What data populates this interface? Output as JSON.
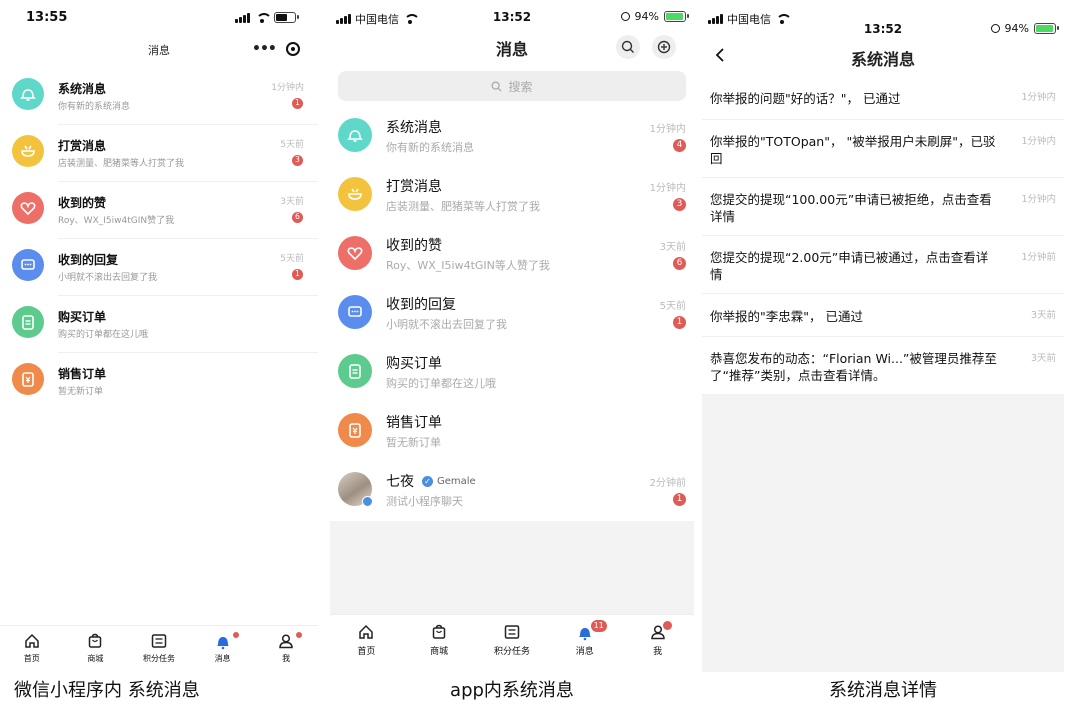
{
  "colors": {
    "system": "#5fd8c9",
    "reward": "#f4c33e",
    "like": "#ee6f68",
    "reply": "#5b8def",
    "buy": "#5ccb8d",
    "sell": "#f08a4b",
    "badge": "#e05a56"
  },
  "panels": [
    {
      "status_time": "13:55",
      "header_title": "消息",
      "items": [
        {
          "icon": "bell-icon",
          "title": "系统消息",
          "sub": "你有新的系统消息",
          "time": "1分钟内",
          "badge": "1"
        },
        {
          "icon": "reward-bowl-icon",
          "title": "打赏消息",
          "sub": "店装测量、肥猪菜等人打赏了我",
          "time": "5天前",
          "badge": "3"
        },
        {
          "icon": "heart-icon",
          "title": "收到的赞",
          "sub": "Roy、WX_I5iw4tGIN赞了我",
          "time": "3天前",
          "badge": "6"
        },
        {
          "icon": "chat-bubble-icon",
          "title": "收到的回复",
          "sub": "小明就不滚出去回复了我",
          "time": "5天前",
          "badge": "1"
        },
        {
          "icon": "clipboard-icon",
          "title": "购买订单",
          "sub": "购买的订单都在这儿哦",
          "time": "",
          "badge": ""
        },
        {
          "icon": "yuan-receipt-icon",
          "title": "销售订单",
          "sub": "暂无新订单",
          "time": "",
          "badge": ""
        }
      ],
      "tabs": [
        "首页",
        "商城",
        "积分任务",
        "消息",
        "我"
      ],
      "caption": "微信小程序内 系统消息"
    },
    {
      "carrier": "中国电信",
      "status_time": "13:52",
      "battery": "94%",
      "header_title": "消息",
      "search_placeholder": "搜索",
      "items": [
        {
          "icon": "bell-icon",
          "title": "系统消息",
          "sub": "你有新的系统消息",
          "time": "1分钟内",
          "badge": "4"
        },
        {
          "icon": "reward-bowl-icon",
          "title": "打赏消息",
          "sub": "店装测量、肥猪菜等人打赏了我",
          "time": "1分钟内",
          "badge": "3"
        },
        {
          "icon": "heart-icon",
          "title": "收到的赞",
          "sub": "Roy、WX_I5iw4tGIN等人赞了我",
          "time": "3天前",
          "badge": "6"
        },
        {
          "icon": "chat-bubble-icon",
          "title": "收到的回复",
          "sub": "小明就不滚出去回复了我",
          "time": "5天前",
          "badge": "1"
        },
        {
          "icon": "clipboard-icon",
          "title": "购买订单",
          "sub": "购买的订单都在这儿哦",
          "time": "",
          "badge": ""
        },
        {
          "icon": "yuan-receipt-icon",
          "title": "销售订单",
          "sub": "暂无新订单",
          "time": "",
          "badge": ""
        },
        {
          "icon": "user-avatar-photo",
          "title": "七夜",
          "verified_name": "Gemale",
          "sub": "测试小程序聊天",
          "time": "2分钟前",
          "badge": "1"
        }
      ],
      "tabs": [
        "首页",
        "商城",
        "积分任务",
        "消息",
        "我"
      ],
      "tab_badge": "11",
      "caption": "app内系统消息"
    },
    {
      "carrier": "中国电信",
      "status_time": "13:52",
      "battery": "94%",
      "header_title": "系统消息",
      "items": [
        {
          "text": "你举报的问题\"好的话？\"， 已通过",
          "time": "1分钟内"
        },
        {
          "text": "你举报的\"TOTOpan\"， \"被举报用户未刷屏\"，已驳回",
          "time": "1分钟内"
        },
        {
          "text": "您提交的提现“100.00元”申请已被拒绝，点击查看详情",
          "time": "1分钟内"
        },
        {
          "text": "您提交的提现“2.00元”申请已被通过，点击查看详情",
          "time": "1分钟前"
        },
        {
          "text": "你举报的\"李忠霖\"， 已通过",
          "time": "3天前"
        },
        {
          "text": "恭喜您发布的动态：“Florian Wi...”被管理员推荐至了“推荐”类别，点击查看详情。",
          "time": "3天前"
        }
      ],
      "caption": "系统消息详情"
    }
  ]
}
